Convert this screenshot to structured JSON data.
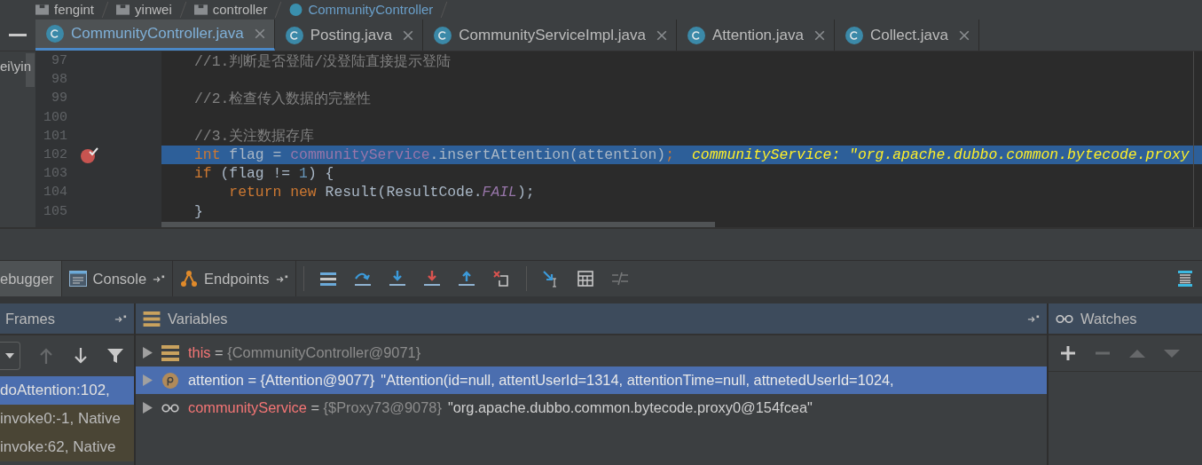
{
  "breadcrumb": [
    {
      "label": "fengint",
      "kind": "folder"
    },
    {
      "label": "yinwei",
      "kind": "folder"
    },
    {
      "label": "controller",
      "kind": "folder"
    },
    {
      "label": "CommunityController",
      "kind": "class"
    }
  ],
  "editor_tabs": [
    {
      "label": "CommunityController.java",
      "selected": true
    },
    {
      "label": "Posting.java",
      "selected": false
    },
    {
      "label": "CommunityServiceImpl.java",
      "selected": false
    },
    {
      "label": "Attention.java",
      "selected": false
    },
    {
      "label": "Collect.java",
      "selected": false
    }
  ],
  "project_panel": {
    "text": "ei\\yin"
  },
  "code_lines": [
    {
      "number": "97",
      "current": false,
      "breakpoint": false,
      "tokens": [
        {
          "t": "//1.判断是否登陆/没登陆直接提示登陆",
          "kind": "comment"
        }
      ]
    },
    {
      "number": "98",
      "current": false,
      "breakpoint": false
    },
    {
      "number": "99",
      "current": false,
      "breakpoint": false,
      "tokens": [
        {
          "t": "//2.检查传入数据的完整性",
          "kind": "comment"
        }
      ]
    },
    {
      "number": "100",
      "current": false,
      "breakpoint": false
    },
    {
      "number": "101",
      "current": false,
      "breakpoint": false,
      "tokens": [
        {
          "t": "//3.关注数据存库",
          "kind": "comment"
        }
      ]
    },
    {
      "number": "102",
      "current": true,
      "breakpoint": true,
      "tokens": [
        {
          "t": "int ",
          "kind": "keyword"
        },
        {
          "t": "flag = ",
          "kind": "plain"
        },
        {
          "t": "communityService",
          "kind": "field"
        },
        {
          "t": ".insertAttention(attention)",
          "kind": "plain"
        },
        {
          "t": ";",
          "kind": "keyword"
        }
      ],
      "hint": "communityService: \"org.apache.dubbo.common.bytecode.proxy"
    },
    {
      "number": "103",
      "current": false,
      "breakpoint": false,
      "tokens": [
        {
          "t": "if ",
          "kind": "keyword"
        },
        {
          "t": "(flag != ",
          "kind": "plain"
        },
        {
          "t": "1",
          "kind": "number"
        },
        {
          "t": ") {",
          "kind": "plain"
        }
      ]
    },
    {
      "number": "104",
      "current": false,
      "breakpoint": false,
      "tokens": [
        {
          "t": "    return new ",
          "kind": "keyword"
        },
        {
          "t": "Result(ResultCode.",
          "kind": "plain"
        },
        {
          "t": "FAIL",
          "kind": "static"
        },
        {
          "t": ");",
          "kind": "plain"
        }
      ]
    },
    {
      "number": "105",
      "current": false,
      "breakpoint": false,
      "tokens": [
        {
          "t": "}",
          "kind": "plain"
        }
      ]
    }
  ],
  "debugger_tabs": [
    {
      "label": "ebugger",
      "kind": "debugger",
      "selected": true
    },
    {
      "label": "Console",
      "kind": "console",
      "selected": false
    },
    {
      "label": "Endpoints",
      "kind": "endpoints",
      "selected": false
    }
  ],
  "debug_toolbar": [
    {
      "kind": "layout",
      "disabled": false
    },
    {
      "kind": "step-over",
      "disabled": false
    },
    {
      "kind": "step-into",
      "disabled": false
    },
    {
      "kind": "force-step-into",
      "disabled": false
    },
    {
      "kind": "step-out",
      "disabled": false
    },
    {
      "kind": "drop-frame",
      "disabled": false
    },
    {
      "kind": "run-to-cursor",
      "disabled": false
    },
    {
      "kind": "evaluate",
      "disabled": false
    },
    {
      "kind": "trace",
      "disabled": true
    }
  ],
  "frames": {
    "title": "Frames",
    "toolbar": [
      {
        "kind": "up",
        "disabled": true
      },
      {
        "kind": "down",
        "disabled": false
      },
      {
        "kind": "filter",
        "disabled": false
      }
    ],
    "items": [
      {
        "label": "doAttention:102,",
        "selected": true,
        "library": false
      },
      {
        "label": "invoke0:-1, Native",
        "selected": false,
        "library": true
      },
      {
        "label": "invoke:62, Native",
        "selected": false,
        "library": true
      }
    ]
  },
  "variables": {
    "title": "Variables",
    "items": [
      {
        "kind": "field",
        "name": "this",
        "op": "=",
        "ref": "{CommunityController@9071}",
        "selected": false
      },
      {
        "kind": "param",
        "name": "attention",
        "op": "=",
        "ref": "{Attention@9077}",
        "string": "\"Attention(id=null, attentUserId=1314, attentionTime=null, attnetedUserId=1024,",
        "selected": true
      },
      {
        "kind": "watch",
        "name": "communityService",
        "op": "=",
        "ref": "{$Proxy73@9078}",
        "string": "\"org.apache.dubbo.common.bytecode.proxy0@154fcea\"",
        "selected": false
      }
    ]
  },
  "watches": {
    "title": "Watches",
    "toolbar": [
      {
        "kind": "add",
        "disabled": false
      },
      {
        "kind": "remove",
        "disabled": true
      },
      {
        "kind": "up",
        "disabled": true
      },
      {
        "kind": "down",
        "disabled": true
      }
    ]
  }
}
